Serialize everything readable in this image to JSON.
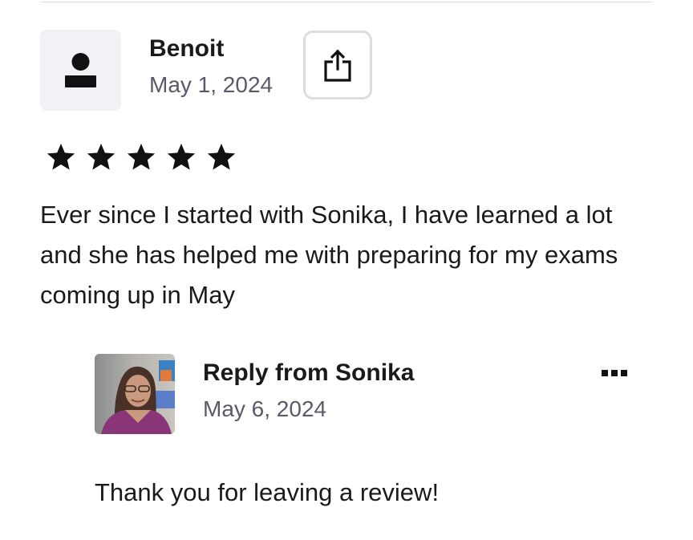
{
  "review": {
    "reviewer_name": "Benoit",
    "date": "May 1, 2024",
    "rating": 5,
    "rating_max": 5,
    "text": "Ever since I started with Sonika, I have learned a lot and she has helped me with preparing for my exams coming up in May",
    "avatar_icon": "user-placeholder-icon",
    "share_icon": "share-icon"
  },
  "reply": {
    "title": "Reply from Sonika",
    "date": "May 6, 2024",
    "text": "Thank you for leaving a review!",
    "more_icon": "more-options-icon"
  },
  "colors": {
    "text_primary": "#1a1a1a",
    "text_secondary": "#5a5a68",
    "avatar_bg": "#f2f2f6",
    "border": "#dcdce4",
    "star": "#111111"
  }
}
